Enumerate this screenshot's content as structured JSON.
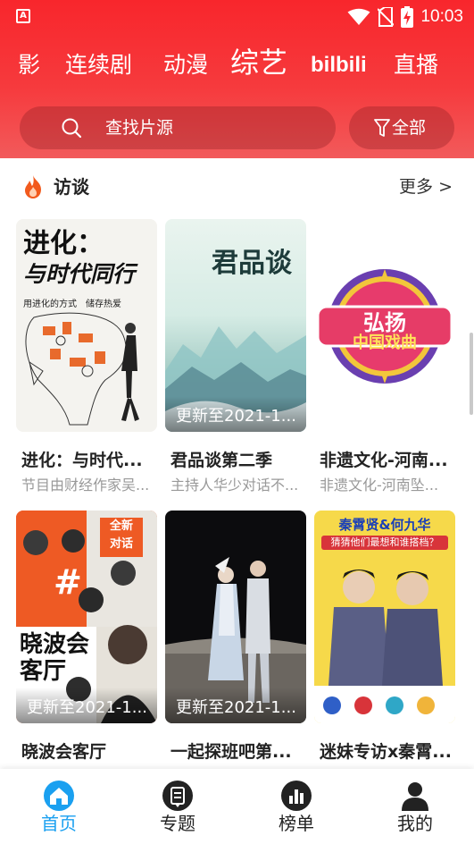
{
  "status_bar": {
    "time": "10:03",
    "left_icon": "A"
  },
  "tabs": [
    "影",
    "连续剧",
    "动漫",
    "综艺",
    "bilbili",
    "直播"
  ],
  "search": {
    "placeholder": "查找片源",
    "filter_label": "全部"
  },
  "section": {
    "title": "访谈",
    "more": "更多 >"
  },
  "cards": [
    {
      "title": "进化：与时代...",
      "desc": "节目由财经作家吴...",
      "update": "",
      "poster_text": {
        "line1": "进化：",
        "line2": "与时代同行",
        "line3": "用进化的方式　储存热爱"
      }
    },
    {
      "title": "君品谈第二季",
      "desc": "主持人华少对话不...",
      "update": "更新至2021-1...",
      "poster_text": {
        "logo": "君品谈"
      }
    },
    {
      "title": "非遗文化-河南...",
      "desc": "非遗文化-河南坠...",
      "update": "",
      "poster_text": {
        "line1": "弘扬",
        "line2": "中国戏曲"
      }
    },
    {
      "title": "晓波会客厅",
      "desc": "",
      "update": "更新至2021-1...",
      "poster_text": {
        "main": "晓波会客厅",
        "badge1": "全新",
        "badge2": "对话",
        "hash": "#"
      }
    },
    {
      "title": "一起探班吧第...",
      "desc": "",
      "update": "更新至2021-1...",
      "poster_text": {}
    },
    {
      "title": "迷妹专访x秦霄...",
      "desc": "",
      "update": "",
      "poster_text": {
        "line1": "秦霄贤&何九华",
        "line2": "猜猜他们最想和谁搭档？"
      }
    }
  ],
  "bottom_nav": [
    {
      "label": "首页",
      "icon": "home-icon",
      "active": true
    },
    {
      "label": "专题",
      "icon": "topic-icon",
      "active": false
    },
    {
      "label": "榜单",
      "icon": "chart-icon",
      "active": false
    },
    {
      "label": "我的",
      "icon": "user-icon",
      "active": false
    }
  ],
  "colors": {
    "header": "#f8262c",
    "active_nav": "#1aa0f0",
    "fire": "#f25a1d"
  }
}
